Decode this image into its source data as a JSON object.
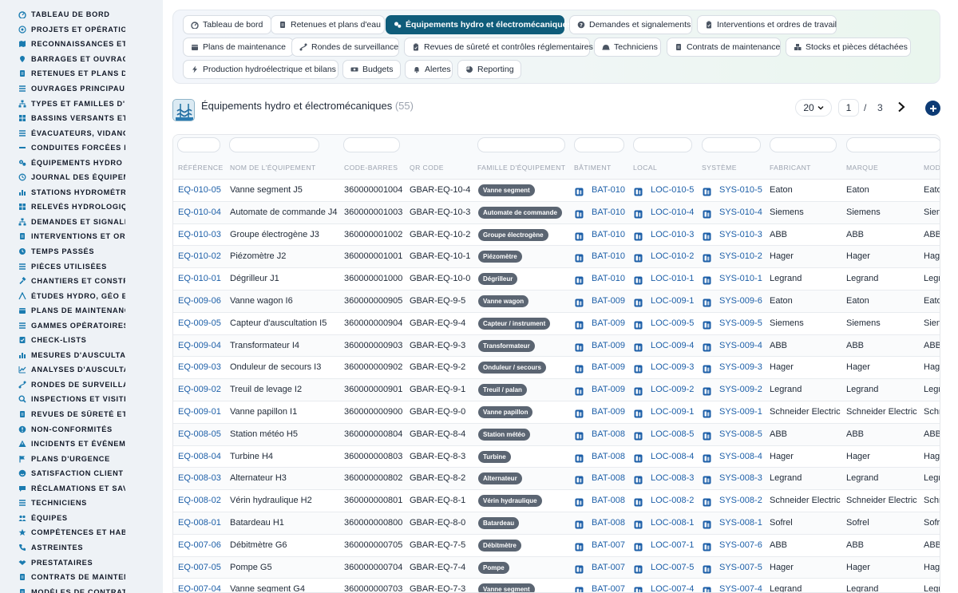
{
  "sidebar": {
    "items": [
      {
        "label": "TABLEAU DE BORD",
        "icon": "dashboard-icon"
      },
      {
        "label": "PROJETS ET OPÉRATIONS",
        "icon": "target-icon"
      },
      {
        "label": "RECONNAISSANCES ET V",
        "icon": "map-icon"
      },
      {
        "label": "BARRAGES ET OUVRAGES",
        "icon": "pin-icon"
      },
      {
        "label": "RETENUES ET PLANS D'EAU",
        "icon": "document-icon"
      },
      {
        "label": "OUVRAGES PRINCIPAUX",
        "icon": "list-icon"
      },
      {
        "label": "TYPES ET FAMILLES D'OUVRAGES",
        "icon": "hierarchy-icon"
      },
      {
        "label": "BASSINS VERSANTS ET AFFLUENTS",
        "icon": "grid-icon"
      },
      {
        "label": "ÉVACUATEURS, VIDANGES",
        "icon": "list-icon"
      },
      {
        "label": "CONDUITES FORCÉES ET",
        "icon": "pipe-icon"
      },
      {
        "label": "ÉQUIPEMENTS HYDRO ET",
        "icon": "gears-icon"
      },
      {
        "label": "JOURNAL DES ÉQUIPEMENTS",
        "icon": "history-icon"
      },
      {
        "label": "STATIONS HYDROMÉTRIQUES",
        "icon": "bars-icon"
      },
      {
        "label": "RELEVÉS HYDROLOGIQUES",
        "icon": "grid-icon"
      },
      {
        "label": "DEMANDES ET SIGNALEMENTS",
        "icon": "hierarchy-icon"
      },
      {
        "label": "INTERVENTIONS ET ORDRES",
        "icon": "document-icon"
      },
      {
        "label": "TEMPS PASSÉS",
        "icon": "clock-icon"
      },
      {
        "label": "PIÈCES UTILISÉES",
        "icon": "list-icon"
      },
      {
        "label": "CHANTIERS ET CONSTRUCTIONS",
        "icon": "hammer-icon"
      },
      {
        "label": "ÉTUDES HYDRO, GÉO ET",
        "icon": "compass-icon"
      },
      {
        "label": "PLANS DE MAINTENANCE",
        "icon": "calendar-icon"
      },
      {
        "label": "GAMMES OPÉRATOIRES",
        "icon": "list-icon"
      },
      {
        "label": "CHECK-LISTS",
        "icon": "checklist-icon"
      },
      {
        "label": "MESURES D'AUSCULTATION",
        "icon": "bars-icon"
      },
      {
        "label": "ANALYSES D'AUSCULTATION",
        "icon": "chart-icon"
      },
      {
        "label": "RONDES DE SURVEILLANCE",
        "icon": "route-icon"
      },
      {
        "label": "INSPECTIONS ET VISITES",
        "icon": "search-icon"
      },
      {
        "label": "REVUES DE SÛRETÉ ET CONTRÔLES",
        "icon": "document-icon"
      },
      {
        "label": "NON-CONFORMITÉS",
        "icon": "alert-icon"
      },
      {
        "label": "INCIDENTS ET ÉVÉNEMENTS",
        "icon": "warning-icon"
      },
      {
        "label": "PLANS D'URGENCE",
        "icon": "flag-icon"
      },
      {
        "label": "SATISFACTION CLIENT",
        "icon": "smile-icon"
      },
      {
        "label": "RÉCLAMATIONS ET SAV",
        "icon": "chat-icon"
      },
      {
        "label": "TECHNICIENS",
        "icon": "list-icon"
      },
      {
        "label": "ÉQUIPES",
        "icon": "team-icon"
      },
      {
        "label": "COMPÉTENCES ET HABILITATIONS",
        "icon": "star-icon"
      },
      {
        "label": "ASTREINTES",
        "icon": "phone-icon"
      },
      {
        "label": "PRESTATAIRES",
        "icon": "handshake-icon"
      },
      {
        "label": "CONTRATS DE MAINTENANCE",
        "icon": "document-icon"
      },
      {
        "label": "MODÈLES DE CONTRATS",
        "icon": "document-icon"
      }
    ]
  },
  "tabs": [
    {
      "label": "Tableau de bord",
      "icon": "dashboard-icon",
      "active": false
    },
    {
      "label": "Retenues et plans d'eau",
      "icon": "document-icon",
      "active": false
    },
    {
      "label": "Équipements hydro et électromécaniques",
      "icon": "gears-icon",
      "active": true
    },
    {
      "label": "Demandes et signalements",
      "icon": "question-icon",
      "active": false
    },
    {
      "label": "Interventions et ordres de travail",
      "icon": "clipboard-icon",
      "active": false
    },
    {
      "label": "Plans de maintenance",
      "icon": "calendar-icon",
      "active": false
    },
    {
      "label": "Rondes de surveillance",
      "icon": "route-icon",
      "active": false
    },
    {
      "label": "Revues de sûreté et contrôles réglementaires",
      "icon": "clipboard-icon",
      "active": false
    },
    {
      "label": "Techniciens",
      "icon": "helmet-icon",
      "active": false
    },
    {
      "label": "Contrats de maintenance",
      "icon": "document-icon",
      "active": false
    },
    {
      "label": "Stocks et pièces détachées",
      "icon": "boxes-icon",
      "active": false
    },
    {
      "label": "Production hydroélectrique et bilans",
      "icon": "bolt-icon",
      "active": false
    },
    {
      "label": "Budgets",
      "icon": "money-icon",
      "active": false
    },
    {
      "label": "Alertes",
      "icon": "bell-icon",
      "active": false
    },
    {
      "label": "Reporting",
      "icon": "pie-icon",
      "active": false
    }
  ],
  "page": {
    "title": "Équipements hydro et électromécaniques",
    "count": "(55)",
    "page_size": "20",
    "current_page": "1",
    "separator": "/",
    "total_pages": "3"
  },
  "table": {
    "columns": [
      "RÉFÉRENCE",
      "NOM DE L'ÉQUIPEMENT",
      "CODE-BARRES",
      "QR CODE",
      "FAMILLE D'ÉQUIPEMENT",
      "BÂTIMENT",
      "LOCAL",
      "SYSTÈME",
      "FABRICANT",
      "MARQUE",
      "MOD"
    ],
    "rows": [
      {
        "ref": "EQ-010-05",
        "name": "Vanne segment J5",
        "barcode": "360000001004",
        "qr": "GBAR-EQ-10-4",
        "family": "Vanne segment",
        "building": "BAT-010",
        "local": "LOC-010-5",
        "system": "SYS-010-5",
        "maker": "Eaton",
        "brand": "Eaton",
        "model": "Eato"
      },
      {
        "ref": "EQ-010-04",
        "name": "Automate de commande J4",
        "barcode": "360000001003",
        "qr": "GBAR-EQ-10-3",
        "family": "Automate de commande",
        "building": "BAT-010",
        "local": "LOC-010-4",
        "system": "SYS-010-4",
        "maker": "Siemens",
        "brand": "Siemens",
        "model": "Sien"
      },
      {
        "ref": "EQ-010-03",
        "name": "Groupe électrogène J3",
        "barcode": "360000001002",
        "qr": "GBAR-EQ-10-2",
        "family": "Groupe électrogène",
        "building": "BAT-010",
        "local": "LOC-010-3",
        "system": "SYS-010-3",
        "maker": "ABB",
        "brand": "ABB",
        "model": "ABB"
      },
      {
        "ref": "EQ-010-02",
        "name": "Piézomètre J2",
        "barcode": "360000001001",
        "qr": "GBAR-EQ-10-1",
        "family": "Piézomètre",
        "building": "BAT-010",
        "local": "LOC-010-2",
        "system": "SYS-010-2",
        "maker": "Hager",
        "brand": "Hager",
        "model": "Hag"
      },
      {
        "ref": "EQ-010-01",
        "name": "Dégrilleur J1",
        "barcode": "360000001000",
        "qr": "GBAR-EQ-10-0",
        "family": "Dégrilleur",
        "building": "BAT-010",
        "local": "LOC-010-1",
        "system": "SYS-010-1",
        "maker": "Legrand",
        "brand": "Legrand",
        "model": "Legr"
      },
      {
        "ref": "EQ-009-06",
        "name": "Vanne wagon I6",
        "barcode": "360000000905",
        "qr": "GBAR-EQ-9-5",
        "family": "Vanne wagon",
        "building": "BAT-009",
        "local": "LOC-009-1",
        "system": "SYS-009-6",
        "maker": "Eaton",
        "brand": "Eaton",
        "model": "Eato"
      },
      {
        "ref": "EQ-009-05",
        "name": "Capteur d'auscultation I5",
        "barcode": "360000000904",
        "qr": "GBAR-EQ-9-4",
        "family": "Capteur / instrument",
        "building": "BAT-009",
        "local": "LOC-009-5",
        "system": "SYS-009-5",
        "maker": "Siemens",
        "brand": "Siemens",
        "model": "Sien"
      },
      {
        "ref": "EQ-009-04",
        "name": "Transformateur I4",
        "barcode": "360000000903",
        "qr": "GBAR-EQ-9-3",
        "family": "Transformateur",
        "building": "BAT-009",
        "local": "LOC-009-4",
        "system": "SYS-009-4",
        "maker": "ABB",
        "brand": "ABB",
        "model": "ABB"
      },
      {
        "ref": "EQ-009-03",
        "name": "Onduleur de secours I3",
        "barcode": "360000000902",
        "qr": "GBAR-EQ-9-2",
        "family": "Onduleur / secours",
        "building": "BAT-009",
        "local": "LOC-009-3",
        "system": "SYS-009-3",
        "maker": "Hager",
        "brand": "Hager",
        "model": "Hag"
      },
      {
        "ref": "EQ-009-02",
        "name": "Treuil de levage I2",
        "barcode": "360000000901",
        "qr": "GBAR-EQ-9-1",
        "family": "Treuil / palan",
        "building": "BAT-009",
        "local": "LOC-009-2",
        "system": "SYS-009-2",
        "maker": "Legrand",
        "brand": "Legrand",
        "model": "Legr"
      },
      {
        "ref": "EQ-009-01",
        "name": "Vanne papillon I1",
        "barcode": "360000000900",
        "qr": "GBAR-EQ-9-0",
        "family": "Vanne papillon",
        "building": "BAT-009",
        "local": "LOC-009-1",
        "system": "SYS-009-1",
        "maker": "Schneider Electric",
        "brand": "Schneider Electric",
        "model": "Schn"
      },
      {
        "ref": "EQ-008-05",
        "name": "Station météo H5",
        "barcode": "360000000804",
        "qr": "GBAR-EQ-8-4",
        "family": "Station météo",
        "building": "BAT-008",
        "local": "LOC-008-5",
        "system": "SYS-008-5",
        "maker": "ABB",
        "brand": "ABB",
        "model": "ABB"
      },
      {
        "ref": "EQ-008-04",
        "name": "Turbine H4",
        "barcode": "360000000803",
        "qr": "GBAR-EQ-8-3",
        "family": "Turbine",
        "building": "BAT-008",
        "local": "LOC-008-4",
        "system": "SYS-008-4",
        "maker": "Hager",
        "brand": "Hager",
        "model": "Hag"
      },
      {
        "ref": "EQ-008-03",
        "name": "Alternateur H3",
        "barcode": "360000000802",
        "qr": "GBAR-EQ-8-2",
        "family": "Alternateur",
        "building": "BAT-008",
        "local": "LOC-008-3",
        "system": "SYS-008-3",
        "maker": "Legrand",
        "brand": "Legrand",
        "model": "Legr"
      },
      {
        "ref": "EQ-008-02",
        "name": "Vérin hydraulique H2",
        "barcode": "360000000801",
        "qr": "GBAR-EQ-8-1",
        "family": "Vérin hydraulique",
        "building": "BAT-008",
        "local": "LOC-008-2",
        "system": "SYS-008-2",
        "maker": "Schneider Electric",
        "brand": "Schneider Electric",
        "model": "Schn"
      },
      {
        "ref": "EQ-008-01",
        "name": "Batardeau H1",
        "barcode": "360000000800",
        "qr": "GBAR-EQ-8-0",
        "family": "Batardeau",
        "building": "BAT-008",
        "local": "LOC-008-1",
        "system": "SYS-008-1",
        "maker": "Sofrel",
        "brand": "Sofrel",
        "model": "Sofr"
      },
      {
        "ref": "EQ-007-06",
        "name": "Débitmètre G6",
        "barcode": "360000000705",
        "qr": "GBAR-EQ-7-5",
        "family": "Débitmètre",
        "building": "BAT-007",
        "local": "LOC-007-1",
        "system": "SYS-007-6",
        "maker": "ABB",
        "brand": "ABB",
        "model": "ABB"
      },
      {
        "ref": "EQ-007-05",
        "name": "Pompe G5",
        "barcode": "360000000704",
        "qr": "GBAR-EQ-7-4",
        "family": "Pompe",
        "building": "BAT-007",
        "local": "LOC-007-5",
        "system": "SYS-007-5",
        "maker": "Hager",
        "brand": "Hager",
        "model": "Hag"
      },
      {
        "ref": "EQ-007-04",
        "name": "Vanne segment G4",
        "barcode": "360000000703",
        "qr": "GBAR-EQ-7-3",
        "family": "Vanne segment",
        "building": "BAT-007",
        "local": "LOC-007-4",
        "system": "SYS-007-4",
        "maker": "Legrand",
        "brand": "Legrand",
        "model": "Legr"
      }
    ]
  },
  "colors": {
    "accent": "#0f5c7a",
    "link": "#1d5fa8",
    "badge": "#5b6572",
    "add_button": "#0d3b75"
  }
}
